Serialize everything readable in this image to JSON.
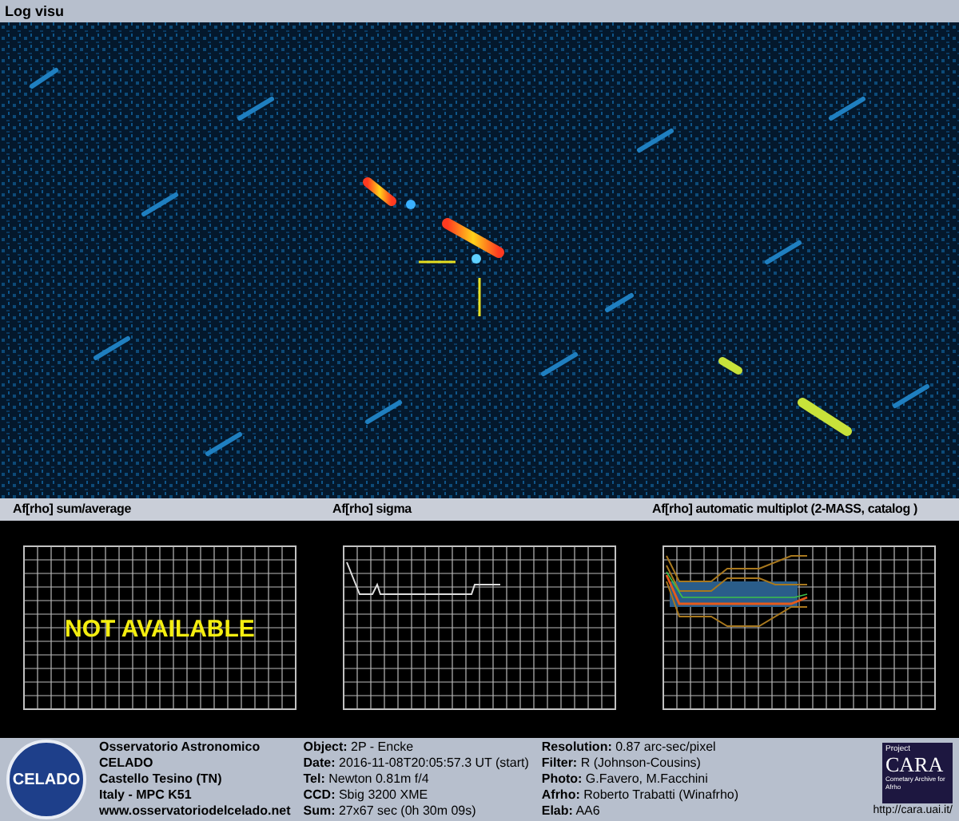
{
  "window": {
    "title": "Log visu"
  },
  "panels": [
    {
      "title": "Af[rho] sum/average",
      "kind": "empty",
      "overlay": "NOT AVAILABLE"
    },
    {
      "title": "Af[rho] sigma",
      "kind": "sigma"
    },
    {
      "title": "Af[rho] automatic multiplot (2-MASS, catalog )",
      "kind": "multiplot"
    }
  ],
  "footer": {
    "logo_text": "CELADO",
    "observatory": [
      "Osservatorio Astronomico",
      "CELADO",
      "Castello Tesino (TN)",
      "Italy - MPC K51",
      "www.osservatoriodelcelado.net"
    ],
    "details": [
      "**Object:** 2P - Encke",
      "**Date:** 2016-11-08T20:05:57.3 UT (start)",
      "**Tel:** Newton 0.81m f/4",
      "**CCD:** Sbig 3200 XME",
      "**Sum:** 27x67 sec (0h 30m 09s)"
    ],
    "details_2": [
      "**Resolution:** 0.87 arc-sec/pixel",
      "**Filter:** R (Johnson-Cousins)",
      "**Photo:** G.Favero, M.Facchini",
      "**Afrho:** Roberto Trabatti (Winafrho)",
      "**Elab:** AA6"
    ],
    "cara": {
      "project": "Project",
      "name": "CARA",
      "subtitle": "Cometary Archive for Afrho",
      "url": "http://cara.uai.it/"
    }
  }
}
